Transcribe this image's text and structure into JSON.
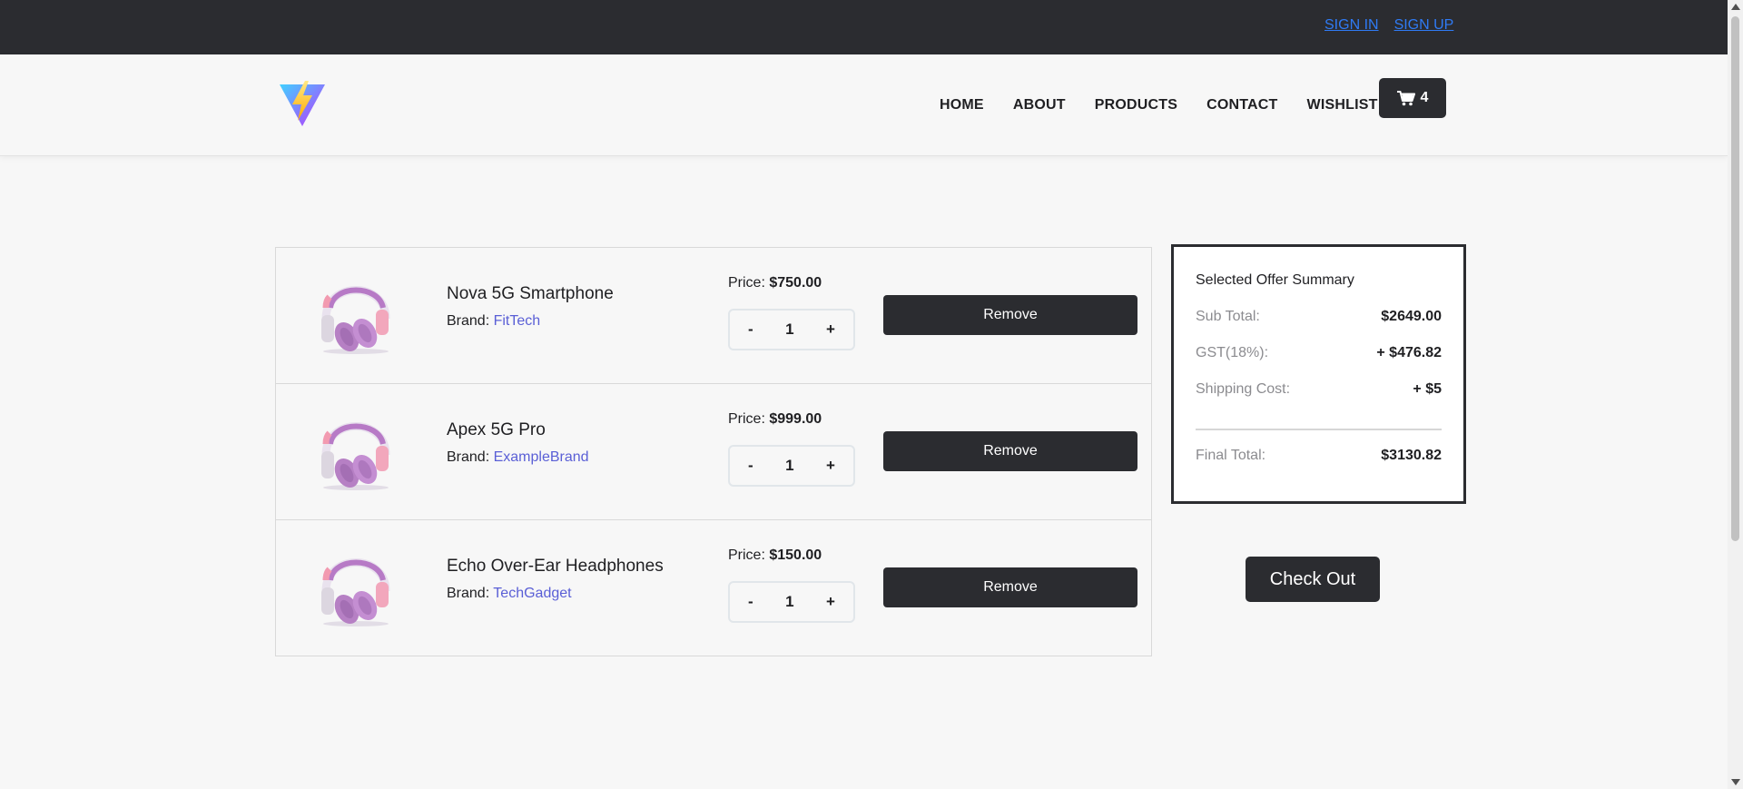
{
  "topbar": {
    "sign_in": "SIGN IN",
    "sign_up": "SIGN UP"
  },
  "header": {
    "logo_icon": "vite-lightning-logo",
    "nav": [
      "HOME",
      "ABOUT",
      "PRODUCTS",
      "CONTACT",
      "WISHLIST"
    ],
    "cart_icon": "cart-icon",
    "cart_count": "4"
  },
  "cart": {
    "items": [
      {
        "name": "Nova 5G Smartphone",
        "brand_label": "Brand:",
        "brand": "FitTech",
        "price_label": "Price:",
        "price": "$750.00",
        "minus": "-",
        "qty": "1",
        "plus": "+",
        "remove": "Remove",
        "image_icon": "headphones-image"
      },
      {
        "name": "Apex 5G Pro",
        "brand_label": "Brand:",
        "brand": "ExampleBrand",
        "price_label": "Price:",
        "price": "$999.00",
        "minus": "-",
        "qty": "1",
        "plus": "+",
        "remove": "Remove",
        "image_icon": "headphones-image"
      },
      {
        "name": "Echo Over-Ear Headphones",
        "brand_label": "Brand:",
        "brand": "TechGadget",
        "price_label": "Price:",
        "price": "$150.00",
        "minus": "-",
        "qty": "1",
        "plus": "+",
        "remove": "Remove",
        "image_icon": "headphones-image"
      }
    ]
  },
  "summary": {
    "title": "Selected Offer Summary",
    "subtotal_label": "Sub Total:",
    "subtotal": "$2649.00",
    "gst_label": "GST(18%):",
    "gst": "+ $476.82",
    "shipping_label": "Shipping Cost:",
    "shipping": "+ $5",
    "final_label": "Final Total:",
    "final": "$3130.82"
  },
  "checkout_label": "Check Out",
  "colors": {
    "dark": "#2b2c30",
    "link": "#2f7bf5",
    "brand": "#5a5fd6",
    "background": "#f7f7f7"
  }
}
